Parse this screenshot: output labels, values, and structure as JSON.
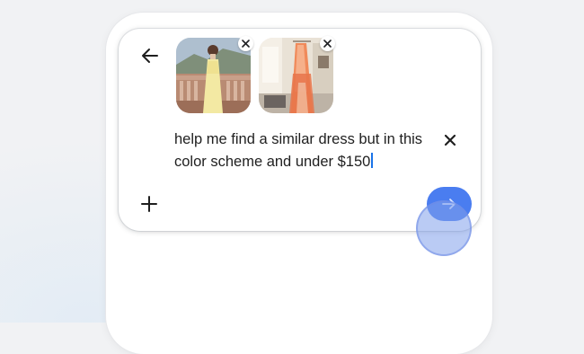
{
  "search_panel": {
    "query": "help me find a similar dress but in this color scheme and under $150",
    "attachments": [
      {
        "icon": "dress-photo-image"
      },
      {
        "icon": "room-color-photo-image"
      }
    ]
  },
  "colors": {
    "accent": "#4a7df0",
    "caret": "#1a73e8",
    "text": "#1f1f1f"
  },
  "icons": {
    "back": "arrow-left-icon",
    "clear": "close-icon",
    "add": "plus-icon",
    "send": "arrow-right-icon",
    "remove_attachment": "close-icon"
  }
}
